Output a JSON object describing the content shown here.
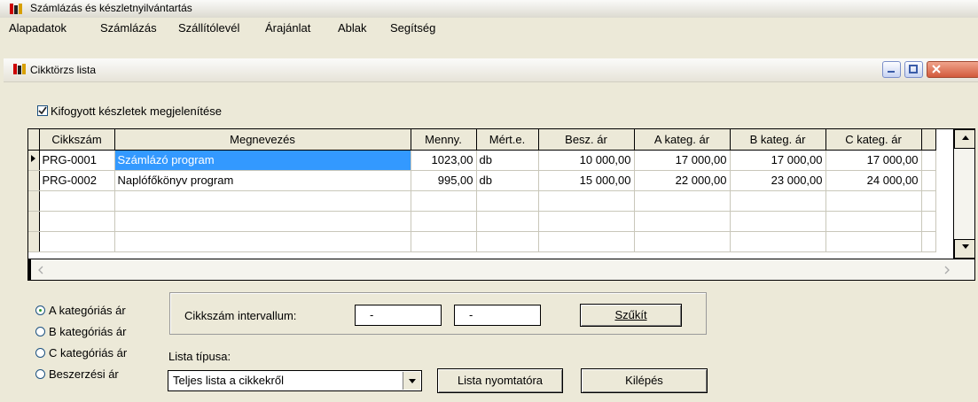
{
  "app": {
    "title": "Számlázás és készletnyilvántartás"
  },
  "menu": [
    {
      "label": "Alapadatok"
    },
    {
      "label": "Számlázás"
    },
    {
      "label": "Szállítólevél"
    },
    {
      "label": "Árajánlat"
    },
    {
      "label": "Ablak"
    },
    {
      "label": "Segítség"
    }
  ],
  "window": {
    "title": "Cikktörzs lista"
  },
  "show_out_of_stock": {
    "label": "Kifogyott készletek megjelenítése",
    "checked": true
  },
  "grid": {
    "columns": [
      "Cikkszám",
      "Megnevezés",
      "Menny.",
      "Mért.e.",
      "Besz. ár",
      "A kateg. ár",
      "B kateg. ár",
      "C kateg. ár"
    ],
    "rows": [
      {
        "code": "PRG-0001",
        "name": "Számlázó program",
        "qty": "1023,00",
        "unit": "db",
        "buy": "10 000,00",
        "a": "17 000,00",
        "b": "17 000,00",
        "c": "17 000,00"
      },
      {
        "code": "PRG-0002",
        "name": "Naplófőkönyv program",
        "qty": "995,00",
        "unit": "db",
        "buy": "15 000,00",
        "a": "22 000,00",
        "b": "23 000,00",
        "c": "24 000,00"
      }
    ]
  },
  "price_category": {
    "options": [
      "A kategóriás ár",
      "B kategóriás ár",
      "C kategóriás ár",
      "Beszerzési ár"
    ],
    "selected": "A kategóriás ár"
  },
  "filter": {
    "interval_label": "Cikkszám intervallum:",
    "from": "-",
    "to": "-",
    "narrow_button": "Szűkít"
  },
  "list_type": {
    "label": "Lista típusa:",
    "selected": "Teljes lista a cikkekről"
  },
  "buttons": {
    "print": "Lista nyomtatóra",
    "exit": "Kilépés"
  }
}
